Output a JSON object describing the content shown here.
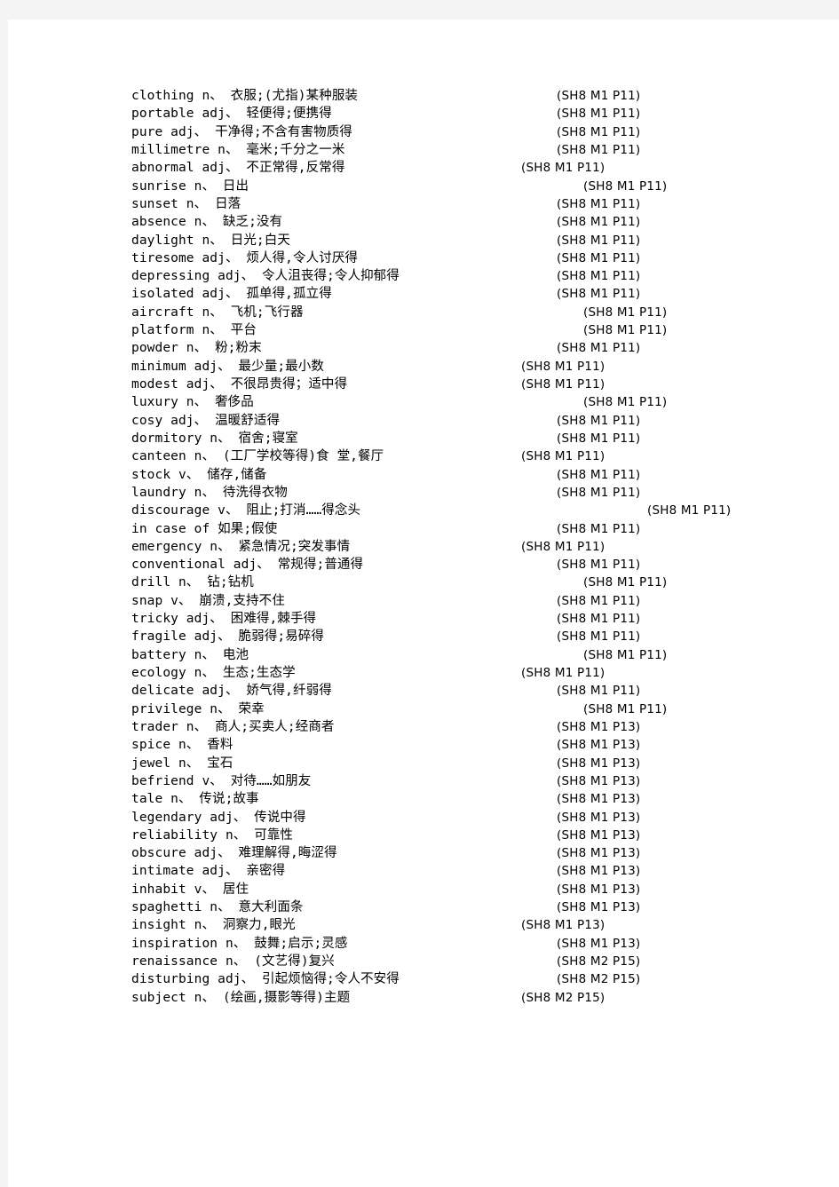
{
  "document": {
    "title": "English Vocabulary List with Textbook References",
    "page_background": "#ffffff",
    "window_background": "#f4f4f4",
    "text_color": "#000000"
  },
  "entries": [
    {
      "term": "clothing n、 衣服;(尤指)某种服装",
      "ref": "(SH8 M1 P11)",
      "indent": "indent-b"
    },
    {
      "term": "portable adj、 轻便得;便携得",
      "ref": "(SH8 M1 P11)",
      "indent": "indent-b"
    },
    {
      "term": "pure adj、 干净得;不含有害物质得",
      "ref": "(SH8 M1 P11)",
      "indent": "indent-b"
    },
    {
      "term": "millimetre n、 毫米;千分之一米",
      "ref": "(SH8 M1 P11)",
      "indent": "indent-b"
    },
    {
      "term": "abnormal adj、 不正常得,反常得",
      "ref": "(SH8 M1 P11)",
      "indent": "indent-a"
    },
    {
      "term": "sunrise n、 日出",
      "ref": "(SH8 M1 P11)",
      "indent": "indent-c"
    },
    {
      "term": "sunset n、 日落",
      "ref": "(SH8 M1 P11)",
      "indent": "indent-b"
    },
    {
      "term": "absence n、 缺乏;没有",
      "ref": "(SH8 M1 P11)",
      "indent": "indent-b"
    },
    {
      "term": "daylight n、 日光;白天",
      "ref": "(SH8 M1 P11)",
      "indent": "indent-b"
    },
    {
      "term": "tiresome adj、 烦人得,令人讨厌得",
      "ref": "(SH8 M1 P11)",
      "indent": "indent-b"
    },
    {
      "term": "depressing adj、 令人沮丧得;令人抑郁得",
      "ref": "(SH8 M1 P11)",
      "indent": "indent-b"
    },
    {
      "term": "isolated adj、 孤单得,孤立得",
      "ref": "(SH8 M1 P11)",
      "indent": "indent-b"
    },
    {
      "term": "aircraft n、 飞机;飞行器",
      "ref": "(SH8 M1 P11)",
      "indent": "indent-c"
    },
    {
      "term": "platform n、 平台",
      "ref": "(SH8 M1 P11)",
      "indent": "indent-c"
    },
    {
      "term": "powder n、 粉;粉末",
      "ref": "(SH8 M1 P11)",
      "indent": "indent-b"
    },
    {
      "term": "minimum adj、 最少量;最小数",
      "ref": "(SH8 M1 P11)",
      "indent": "indent-a"
    },
    {
      "term": "modest adj、 不很昂贵得；适中得",
      "ref": "(SH8 M1 P11)",
      "indent": "indent-a"
    },
    {
      "term": "luxury n、 奢侈品",
      "ref": "(SH8 M1 P11)",
      "indent": "indent-c"
    },
    {
      "term": "cosy adj、 温暖舒适得",
      "ref": "(SH8 M1 P11)",
      "indent": "indent-b"
    },
    {
      "term": "dormitory n、 宿舍;寝室",
      "ref": "(SH8 M1 P11)",
      "indent": "indent-b"
    },
    {
      "term": "canteen n、 (工厂学校等得)食 堂,餐厅",
      "ref": "(SH8 M1 P11)",
      "indent": "indent-a"
    },
    {
      "term": "stock v、 储存,储备",
      "ref": "(SH8 M1 P11)",
      "indent": "indent-b"
    },
    {
      "term": "laundry n、 待洗得衣物",
      "ref": "(SH8 M1 P11)",
      "indent": "indent-b"
    },
    {
      "term": "discourage v、 阻止;打消……得念头",
      "ref": "(SH8 M1 P11)",
      "indent": "indent-d"
    },
    {
      "term": "in case of 如果;假使",
      "ref": "(SH8 M1 P11)",
      "indent": "indent-b"
    },
    {
      "term": "emergency n、 紧急情况;突发事情",
      "ref": "(SH8 M1 P11)",
      "indent": "indent-a"
    },
    {
      "term": "conventional adj、 常规得;普通得",
      "ref": "(SH8 M1 P11)",
      "indent": "indent-b"
    },
    {
      "term": "drill n、 钻;钻机",
      "ref": "(SH8 M1 P11)",
      "indent": "indent-c"
    },
    {
      "term": "snap v、 崩溃,支持不住",
      "ref": "(SH8 M1 P11)",
      "indent": "indent-b"
    },
    {
      "term": "tricky adj、 困难得,棘手得",
      "ref": "(SH8 M1 P11)",
      "indent": "indent-b"
    },
    {
      "term": "fragile adj、 脆弱得;易碎得",
      "ref": "(SH8 M1 P11)",
      "indent": "indent-b"
    },
    {
      "term": "battery n、 电池",
      "ref": "(SH8 M1 P11)",
      "indent": "indent-c"
    },
    {
      "term": "ecology n、 生态;生态学",
      "ref": "(SH8 M1 P11)",
      "indent": "indent-a"
    },
    {
      "term": "delicate adj、 娇气得,纤弱得",
      "ref": "(SH8 M1 P11)",
      "indent": "indent-b"
    },
    {
      "term": "privilege n、 荣幸",
      "ref": "(SH8 M1 P11)",
      "indent": "indent-c"
    },
    {
      "term": "trader n、 商人;买卖人;经商者",
      "ref": "(SH8 M1 P13)",
      "indent": "indent-b"
    },
    {
      "term": "spice n、 香料",
      "ref": "(SH8 M1 P13)",
      "indent": "indent-b"
    },
    {
      "term": "jewel n、 宝石",
      "ref": "(SH8 M1 P13)",
      "indent": "indent-b"
    },
    {
      "term": "befriend v、 对待……如朋友",
      "ref": "(SH8 M1 P13)",
      "indent": "indent-b"
    },
    {
      "term": "tale n、 传说;故事",
      "ref": "(SH8 M1 P13)",
      "indent": "indent-b"
    },
    {
      "term": "legendary adj、 传说中得",
      "ref": "(SH8 M1 P13)",
      "indent": "indent-b"
    },
    {
      "term": "reliability n、 可靠性",
      "ref": "(SH8 M1 P13)",
      "indent": "indent-b"
    },
    {
      "term": "obscure adj、 难理解得,晦涩得",
      "ref": "(SH8 M1 P13)",
      "indent": "indent-b"
    },
    {
      "term": "intimate adj、 亲密得",
      "ref": "(SH8 M1 P13)",
      "indent": "indent-b"
    },
    {
      "term": "inhabit v、 居住",
      "ref": "(SH8 M1 P13)",
      "indent": "indent-b"
    },
    {
      "term": "spaghetti n、 意大利面条",
      "ref": "(SH8 M1 P13)",
      "indent": "indent-b"
    },
    {
      "term": "insight n、 洞察力,眼光",
      "ref": "(SH8 M1 P13)",
      "indent": "indent-a"
    },
    {
      "term": "inspiration n、 鼓舞;启示;灵感",
      "ref": "(SH8 M1 P13)",
      "indent": "indent-b"
    },
    {
      "term": "renaissance n、 (文艺得)复兴",
      "ref": "(SH8 M2 P15)",
      "indent": "indent-b"
    },
    {
      "term": "disturbing adj、 引起烦恼得;令人不安得",
      "ref": "(SH8 M2 P15)",
      "indent": "indent-b"
    },
    {
      "term": "subject n、 (绘画,摄影等得)主题",
      "ref": "(SH8 M2 P15)",
      "indent": "indent-a"
    }
  ]
}
